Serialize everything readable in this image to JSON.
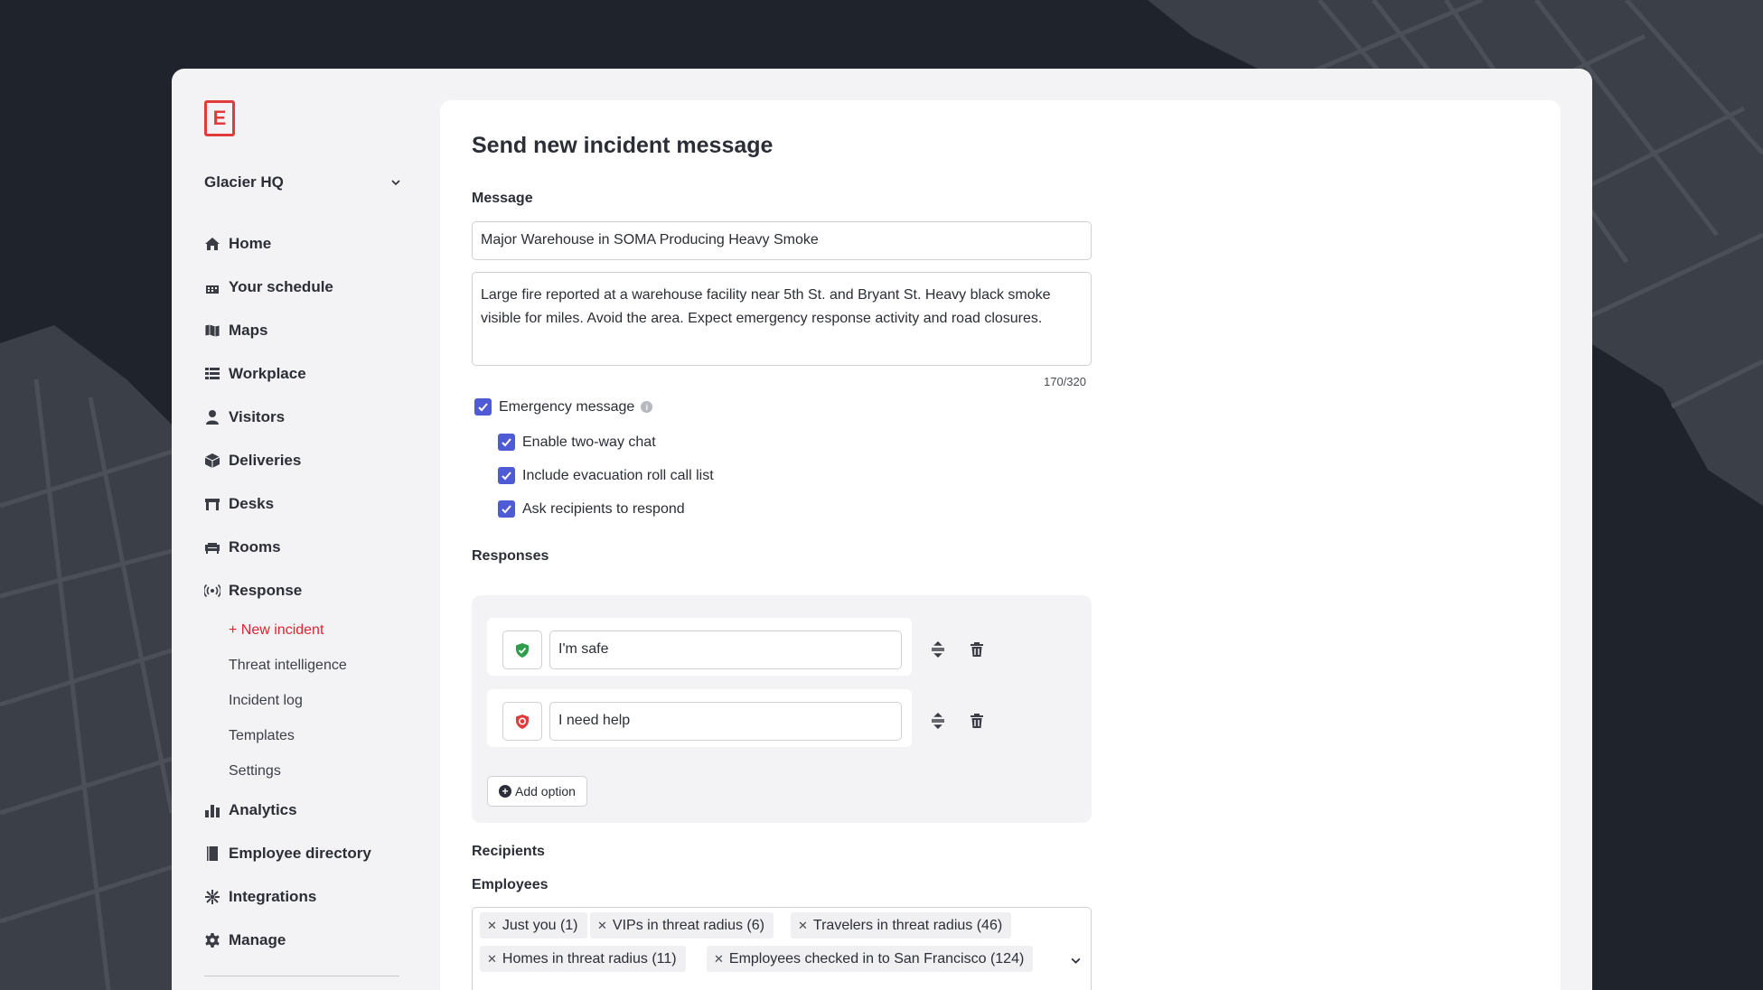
{
  "app": {
    "logo_text": "E",
    "org_name": "Glacier HQ"
  },
  "sidebar": {
    "items": [
      {
        "label": "Home",
        "icon": "home-icon"
      },
      {
        "label": "Your schedule",
        "icon": "calendar-icon"
      },
      {
        "label": "Maps",
        "icon": "map-icon"
      },
      {
        "label": "Workplace",
        "icon": "list-icon"
      },
      {
        "label": "Visitors",
        "icon": "person-icon"
      },
      {
        "label": "Deliveries",
        "icon": "package-icon"
      },
      {
        "label": "Desks",
        "icon": "desk-icon"
      },
      {
        "label": "Rooms",
        "icon": "couch-icon"
      },
      {
        "label": "Response",
        "icon": "broadcast-icon"
      }
    ],
    "response_subitems": [
      {
        "label": "+ New incident",
        "active": true
      },
      {
        "label": "Threat intelligence",
        "active": false
      },
      {
        "label": "Incident log",
        "active": false
      },
      {
        "label": "Templates",
        "active": false
      },
      {
        "label": "Settings",
        "active": false
      }
    ],
    "items_after": [
      {
        "label": "Analytics",
        "icon": "bar-chart-icon"
      },
      {
        "label": "Employee directory",
        "icon": "book-icon"
      },
      {
        "label": "Integrations",
        "icon": "integrations-icon"
      },
      {
        "label": "Manage",
        "icon": "gear-icon"
      }
    ]
  },
  "form": {
    "title": "Send new incident message",
    "message_label": "Message",
    "subject_value": "Major Warehouse in SOMA Producing Heavy Smoke",
    "body_value": "Large fire reported at a warehouse facility near 5th St. and Bryant St. Heavy black smoke visible for miles. Avoid the area. Expect emergency response activity and road closures.",
    "char_count": "170/320",
    "emergency_label": "Emergency message",
    "emergency_checked": true,
    "options": [
      {
        "label": "Enable two-way chat",
        "checked": true
      },
      {
        "label": "Include evacuation roll call list",
        "checked": true
      },
      {
        "label": "Ask recipients to respond",
        "checked": true
      }
    ],
    "responses_label": "Responses",
    "responses": [
      {
        "value": "I'm safe",
        "icon": "shield-check-icon",
        "color": "#2e9e4a"
      },
      {
        "value": "I need help",
        "icon": "shield-alert-icon",
        "color": "#e23b3b"
      }
    ],
    "add_option_label": "Add option",
    "recipients_label": "Recipients",
    "employees_label": "Employees",
    "employee_tags": [
      "Just you (1)",
      "VIPs in threat radius (6)",
      "Travelers in threat radius (46)",
      "Homes in threat radius (11)",
      "Employees checked in to San Francisco (124)"
    ]
  },
  "colors": {
    "accent": "#4f5bd5",
    "active_nav": "#e0242f",
    "background": "#1f232c"
  }
}
